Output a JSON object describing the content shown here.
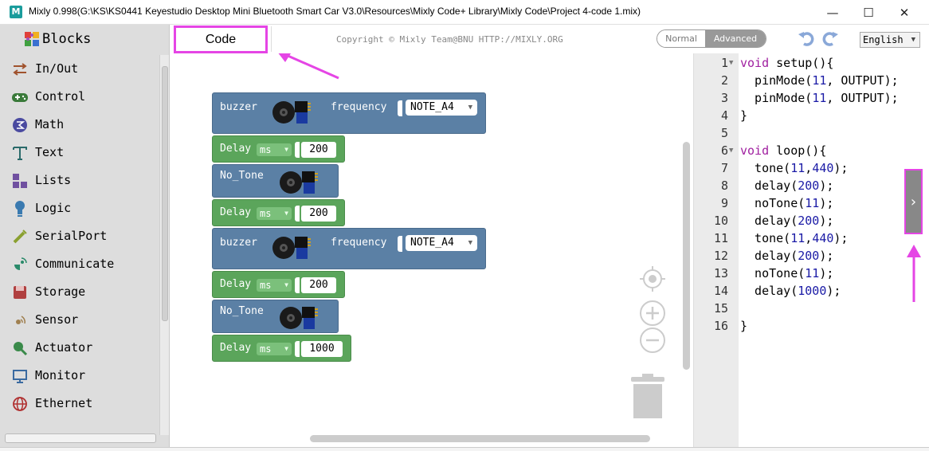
{
  "window": {
    "title": "Mixly 0.998(G:\\KS\\KS0441 Keyestudio Desktop Mini Bluetooth Smart Car V3.0\\Resources\\Mixly Code+ Library\\Mixly Code\\Project 4-code 1.mix)",
    "app_icon_letter": "M",
    "minimize": "—",
    "maximize": "☐",
    "close": "✕"
  },
  "sidebar": {
    "header": "Blocks",
    "categories": [
      {
        "label": "In/Out",
        "icon": "in-out-icon",
        "color": "#a0522d"
      },
      {
        "label": "Control",
        "icon": "control-icon",
        "color": "#3a7a3a"
      },
      {
        "label": "Math",
        "icon": "math-icon",
        "color": "#4a4aa0"
      },
      {
        "label": "Text",
        "icon": "text-icon",
        "color": "#2a6a6a"
      },
      {
        "label": "Lists",
        "icon": "lists-icon",
        "color": "#7050a0"
      },
      {
        "label": "Logic",
        "icon": "logic-icon",
        "color": "#3a7ab0"
      },
      {
        "label": "SerialPort",
        "icon": "serialport-icon",
        "color": "#8aa030"
      },
      {
        "label": "Communicate",
        "icon": "communicate-icon",
        "color": "#2a8a6a"
      },
      {
        "label": "Storage",
        "icon": "storage-icon",
        "color": "#b04040"
      },
      {
        "label": "Sensor",
        "icon": "sensor-icon",
        "color": "#a08050"
      },
      {
        "label": "Actuator",
        "icon": "actuator-icon",
        "color": "#3a8a4a"
      },
      {
        "label": "Monitor",
        "icon": "monitor-icon",
        "color": "#3a6aa0"
      },
      {
        "label": "Ethernet",
        "icon": "ethernet-icon",
        "color": "#b03030"
      }
    ]
  },
  "toolbar": {
    "code_tab": "Code",
    "copyright": "Copyright © Mixly Team@BNU HTTP://MIXLY.ORG",
    "mode_normal": "Normal",
    "mode_advanced": "Advanced",
    "language": "English"
  },
  "blocks": {
    "buzzer1": {
      "label": "buzzer",
      "freq_label": "frequency",
      "note": "NOTE_A4"
    },
    "delay1": {
      "label": "Delay",
      "unit": "ms",
      "value": "200"
    },
    "notone1": {
      "label": "No_Tone"
    },
    "delay2": {
      "label": "Delay",
      "unit": "ms",
      "value": "200"
    },
    "buzzer2": {
      "label": "buzzer",
      "freq_label": "frequency",
      "note": "NOTE_A4"
    },
    "delay3": {
      "label": "Delay",
      "unit": "ms",
      "value": "200"
    },
    "notone2": {
      "label": "No_Tone"
    },
    "delay4": {
      "label": "Delay",
      "unit": "ms",
      "value": "1000"
    }
  },
  "code": {
    "lines": [
      {
        "n": "1",
        "fold": true
      },
      {
        "n": "2",
        "fold": false
      },
      {
        "n": "3",
        "fold": false
      },
      {
        "n": "4",
        "fold": false
      },
      {
        "n": "5",
        "fold": false
      },
      {
        "n": "6",
        "fold": true
      },
      {
        "n": "7",
        "fold": false
      },
      {
        "n": "8",
        "fold": false
      },
      {
        "n": "9",
        "fold": false
      },
      {
        "n": "10",
        "fold": false
      },
      {
        "n": "11",
        "fold": false
      },
      {
        "n": "12",
        "fold": false
      },
      {
        "n": "13",
        "fold": false
      },
      {
        "n": "14",
        "fold": false
      },
      {
        "n": "15",
        "fold": false
      },
      {
        "n": "16",
        "fold": false
      }
    ],
    "tokens": {
      "l1_kw": "void",
      "l1_rest": " setup(){",
      "l2_a": "  pinMode(",
      "l2_n": "11",
      "l2_b": ", OUTPUT);",
      "l3_a": "  pinMode(",
      "l3_n": "11",
      "l3_b": ", OUTPUT);",
      "l4": "}",
      "l6_kw": "void",
      "l6_rest": " loop(){",
      "l7_a": "  tone(",
      "l7_n1": "11",
      "l7_c": ",",
      "l7_n2": "440",
      "l7_b": ");",
      "l8_a": "  delay(",
      "l8_n": "200",
      "l8_b": ");",
      "l9_a": "  noTone(",
      "l9_n": "11",
      "l9_b": ");",
      "l10_a": "  delay(",
      "l10_n": "200",
      "l10_b": ");",
      "l11_a": "  tone(",
      "l11_n1": "11",
      "l11_c": ",",
      "l11_n2": "440",
      "l11_b": ");",
      "l12_a": "  delay(",
      "l12_n": "200",
      "l12_b": ");",
      "l13_a": "  noTone(",
      "l13_n": "11",
      "l13_b": ");",
      "l14_a": "  delay(",
      "l14_n": "1000",
      "l14_b": ");",
      "l16": "}"
    }
  },
  "colors": {
    "accent_annotation": "#e545e5",
    "block_blue": "#5b80a5",
    "block_green": "#5ba55b",
    "keyword": "#a020a0",
    "number": "#1a1aa6"
  }
}
